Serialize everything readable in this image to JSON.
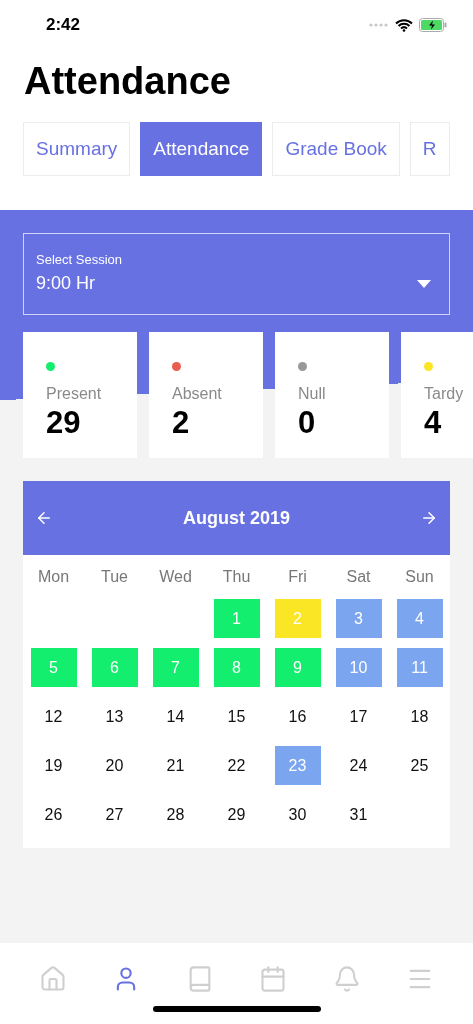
{
  "status_bar": {
    "time": "2:42"
  },
  "title": "Attendance",
  "tabs": [
    {
      "label": "Summary",
      "selected": false
    },
    {
      "label": "Attendance",
      "selected": true
    },
    {
      "label": "Grade Book",
      "selected": false
    },
    {
      "label": "R",
      "selected": false
    }
  ],
  "session": {
    "label": "Select Session",
    "value": "9:00 Hr"
  },
  "stats": [
    {
      "label": "Present",
      "value": "29",
      "color": "#13ee6e"
    },
    {
      "label": "Absent",
      "value": "2",
      "color": "#ea5d4e"
    },
    {
      "label": "Null",
      "value": "0",
      "color": "#989898"
    },
    {
      "label": "Tardy",
      "value": "4",
      "color": "#fbe625"
    }
  ],
  "calendar": {
    "month": "August 2019",
    "weekdays": [
      "Mon",
      "Tue",
      "Wed",
      "Thu",
      "Fri",
      "Sat",
      "Sun"
    ],
    "weeks": [
      [
        {
          "kind": "blank"
        },
        {
          "kind": "blank"
        },
        {
          "kind": "blank"
        },
        {
          "kind": "day",
          "day": "1",
          "color": "#13ee6e"
        },
        {
          "kind": "day",
          "day": "2",
          "color": "#fbe625"
        },
        {
          "kind": "day",
          "day": "3",
          "color": "#7ba5ef"
        },
        {
          "kind": "day",
          "day": "4",
          "color": "#7ba5ef"
        }
      ],
      [
        {
          "kind": "day",
          "day": "5",
          "color": "#13ee6e"
        },
        {
          "kind": "day",
          "day": "6",
          "color": "#13ee6e"
        },
        {
          "kind": "day",
          "day": "7",
          "color": "#13ee6e"
        },
        {
          "kind": "day",
          "day": "8",
          "color": "#13ee6e"
        },
        {
          "kind": "day",
          "day": "9",
          "color": "#13ee6e"
        },
        {
          "kind": "day",
          "day": "10",
          "color": "#7ba5ef"
        },
        {
          "kind": "day",
          "day": "11",
          "color": "#7ba5ef"
        }
      ],
      [
        {
          "kind": "day",
          "day": "12"
        },
        {
          "kind": "day",
          "day": "13"
        },
        {
          "kind": "day",
          "day": "14"
        },
        {
          "kind": "day",
          "day": "15"
        },
        {
          "kind": "day",
          "day": "16"
        },
        {
          "kind": "day",
          "day": "17"
        },
        {
          "kind": "day",
          "day": "18"
        }
      ],
      [
        {
          "kind": "day",
          "day": "19"
        },
        {
          "kind": "day",
          "day": "20"
        },
        {
          "kind": "day",
          "day": "21"
        },
        {
          "kind": "day",
          "day": "22"
        },
        {
          "kind": "day",
          "day": "23",
          "color": "#7ba5ef"
        },
        {
          "kind": "day",
          "day": "24"
        },
        {
          "kind": "day",
          "day": "25"
        }
      ],
      [
        {
          "kind": "day",
          "day": "26"
        },
        {
          "kind": "day",
          "day": "27"
        },
        {
          "kind": "day",
          "day": "28"
        },
        {
          "kind": "day",
          "day": "29"
        },
        {
          "kind": "day",
          "day": "30"
        },
        {
          "kind": "day",
          "day": "31"
        },
        {
          "kind": "blank"
        }
      ]
    ]
  },
  "bottom_nav": [
    {
      "selected": false
    },
    {
      "selected": true
    },
    {
      "selected": false
    },
    {
      "selected": false
    },
    {
      "selected": false
    },
    {
      "selected": false
    }
  ]
}
